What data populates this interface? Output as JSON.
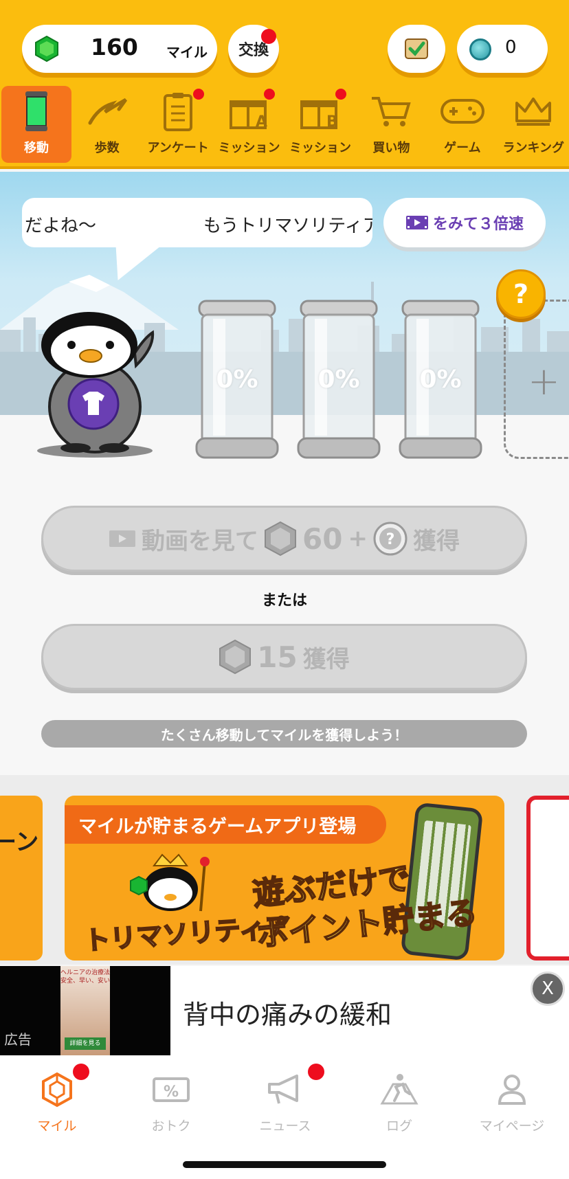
{
  "header": {
    "miles_value": "160",
    "miles_unit": "マイル",
    "exchange_label": "交換",
    "ticket_count": "0"
  },
  "nav": {
    "items": [
      {
        "label": "移動",
        "icon": "capsule-icon",
        "active": true,
        "dot": false
      },
      {
        "label": "歩数",
        "icon": "footprint-icon",
        "active": false,
        "dot": false
      },
      {
        "label": "アンケート",
        "icon": "clipboard-icon",
        "active": false,
        "dot": true
      },
      {
        "label": "ミッション",
        "icon": "gift-a-icon",
        "active": false,
        "dot": true
      },
      {
        "label": "ミッション",
        "icon": "gift-b-icon",
        "active": false,
        "dot": true
      },
      {
        "label": "買い物",
        "icon": "cart-icon",
        "active": false,
        "dot": false
      },
      {
        "label": "ゲーム",
        "icon": "gamepad-icon",
        "active": false,
        "dot": false
      },
      {
        "label": "ランキング",
        "icon": "crown-icon",
        "active": false,
        "dot": false
      }
    ]
  },
  "scene": {
    "speech_text": "だよね〜　　　　　　もうトリマソリティア試",
    "video_speed_label": "をみて３倍速",
    "question_mark": "?",
    "capsules": [
      {
        "percent": "0%"
      },
      {
        "percent": "0%"
      },
      {
        "percent": "0%"
      }
    ],
    "add_symbol": "+"
  },
  "actions": {
    "video_reward_prefix": "動画を見て",
    "video_reward_amount": "60",
    "video_reward_plus": "+",
    "video_reward_suffix": "獲得",
    "or_text": "または",
    "plain_reward_amount": "15",
    "plain_reward_suffix": "獲得",
    "hint_text": "たくさん移動してマイルを獲得しよう！"
  },
  "banner": {
    "tag_text": "マイルが貯まるゲームアプリ登場",
    "logo_text": "トリマソリティア",
    "catch_line1": "遊ぶだけで",
    "catch_line2": "ポイント貯まる",
    "left_partial": "ーン"
  },
  "ad": {
    "label": "広告",
    "thumb_text": "ヘルニアの治療法 安全、早い、安い",
    "thumb_button": "詳細を見る",
    "title": "背中の痛みの緩和",
    "close_label": "X"
  },
  "tabbar": {
    "items": [
      {
        "label": "マイル",
        "icon": "hexagon-gem-icon",
        "active": true,
        "dot": true
      },
      {
        "label": "おトク",
        "icon": "coupon-icon",
        "active": false,
        "dot": false
      },
      {
        "label": "ニュース",
        "icon": "megaphone-icon",
        "active": false,
        "dot": true
      },
      {
        "label": "ログ",
        "icon": "walker-icon",
        "active": false,
        "dot": false
      },
      {
        "label": "マイページ",
        "icon": "person-icon",
        "active": false,
        "dot": false
      }
    ]
  },
  "colors": {
    "header_bg": "#fbbd0e",
    "accent_orange": "#f5741c",
    "notification_red": "#ee0d1e",
    "video_purple": "#6a3fb3"
  }
}
